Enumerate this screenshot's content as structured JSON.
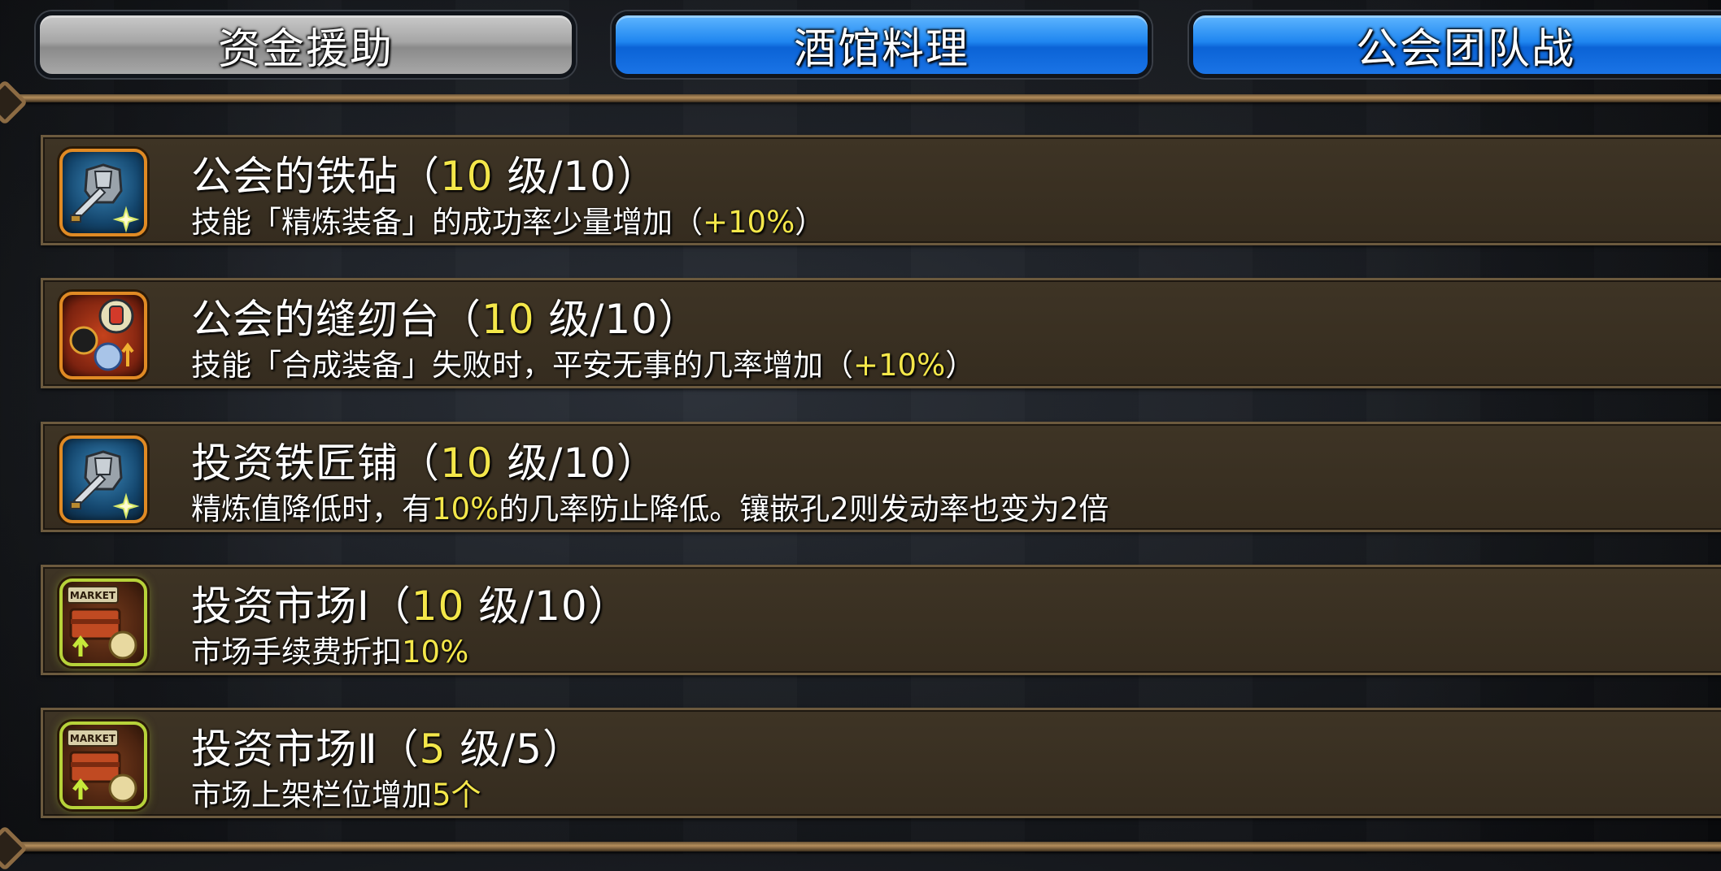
{
  "tabs": [
    {
      "label": "资金援助",
      "state": "inactive"
    },
    {
      "label": "酒馆料理",
      "state": "active"
    },
    {
      "label": "公会团队战",
      "state": "active"
    }
  ],
  "skills": [
    {
      "icon": "anvil-armor-icon",
      "name": "公会的铁砧",
      "level": "10",
      "level_suffix": " 级/10）",
      "desc": "技能「精炼装备」的成功率少量增加（",
      "desc_hl": "+10%",
      "desc_tail": "）"
    },
    {
      "icon": "sewing-table-icon",
      "name": "公会的缝纫台",
      "level": "10",
      "level_suffix": " 级/10）",
      "desc": "技能「合成装备」失败时，平安无事的几率增加（",
      "desc_hl": "+10%",
      "desc_tail": "）"
    },
    {
      "icon": "anvil-armor-icon",
      "name": "投资铁匠铺",
      "level": "10",
      "level_suffix": " 级/10）",
      "desc": "精炼值降低时，有",
      "desc_hl": "10%",
      "desc_tail": "的几率防止降低。镶嵌孔2则发动率也变为2倍"
    },
    {
      "icon": "market-icon",
      "name": "投资市场Ⅰ",
      "level": "10",
      "level_suffix": " 级/10）",
      "desc": "市场手续费折扣",
      "desc_hl": "10%",
      "desc_tail": ""
    },
    {
      "icon": "market-icon",
      "name": "投资市场Ⅱ",
      "level": "5",
      "level_suffix": " 级/5）",
      "desc": "市场上架栏位增加",
      "desc_hl": "5个",
      "desc_tail": ""
    }
  ],
  "icon_text": {
    "market_sign": "MARKET"
  },
  "colors": {
    "highlight": "#f4e74a",
    "tab_active": "#1f86f0",
    "tab_inactive": "#a6a6a6",
    "row_bg": "#3a3022"
  }
}
